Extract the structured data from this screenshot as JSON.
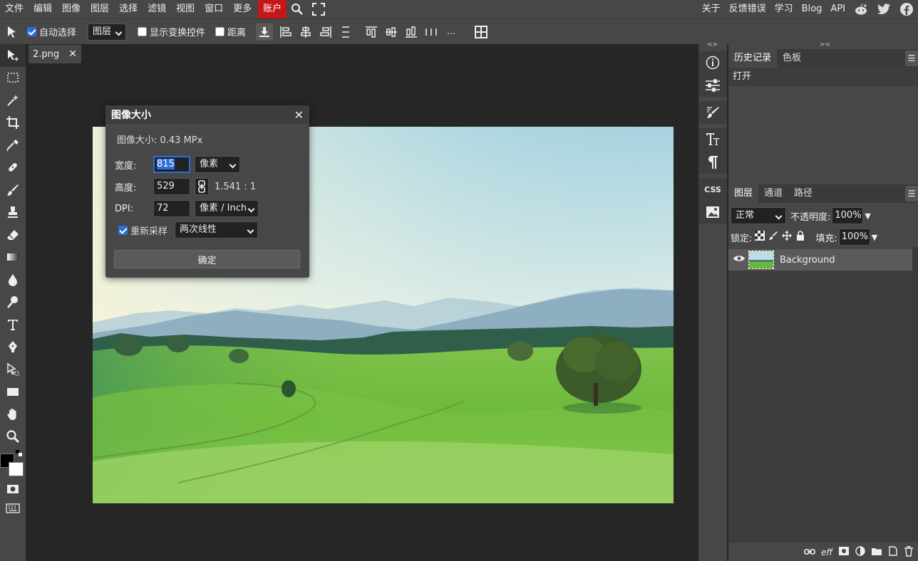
{
  "menu": {
    "items": [
      "文件",
      "编辑",
      "图像",
      "图层",
      "选择",
      "滤镜",
      "视图",
      "窗口",
      "更多"
    ],
    "account": "账户",
    "right": [
      "关于",
      "反馈错误",
      "学习",
      "Blog",
      "API"
    ]
  },
  "options": {
    "auto_select_label": "自动选择",
    "auto_select_checked": true,
    "layer_select": "图层",
    "show_transform_label": "显示变换控件",
    "distance_label": "距离",
    "more": "..."
  },
  "tab": {
    "name": "2.png",
    "close": "✕"
  },
  "dialog": {
    "title": "图像大小",
    "close": "✕",
    "size_info": "图像大小: 0.43 MPx",
    "width_label": "宽度:",
    "width_value": "815",
    "width_unit": "像素",
    "height_label": "高度:",
    "height_value": "529",
    "ratio": "1.541 : 1",
    "dpi_label": "DPI:",
    "dpi_value": "72",
    "dpi_unit": "像素 / Inch",
    "resample_label": "重新采样",
    "resample_checked": true,
    "resample_method": "两次线性",
    "ok": "确定"
  },
  "history_panel": {
    "tabs": [
      "历史记录",
      "色板"
    ],
    "items": [
      "打开"
    ]
  },
  "layers_panel": {
    "tabs": [
      "图层",
      "通道",
      "路径"
    ],
    "blend_mode": "正常",
    "opacity_label": "不透明度:",
    "opacity": "100%",
    "lock_label": "锁定:",
    "fill_label": "填充:",
    "fill": "100%",
    "layers": [
      {
        "name": "Background"
      }
    ],
    "footer_eff": "eff"
  },
  "strip": {
    "css": "CSS",
    "arrows_left": "<>",
    "arrows_right": "><"
  }
}
